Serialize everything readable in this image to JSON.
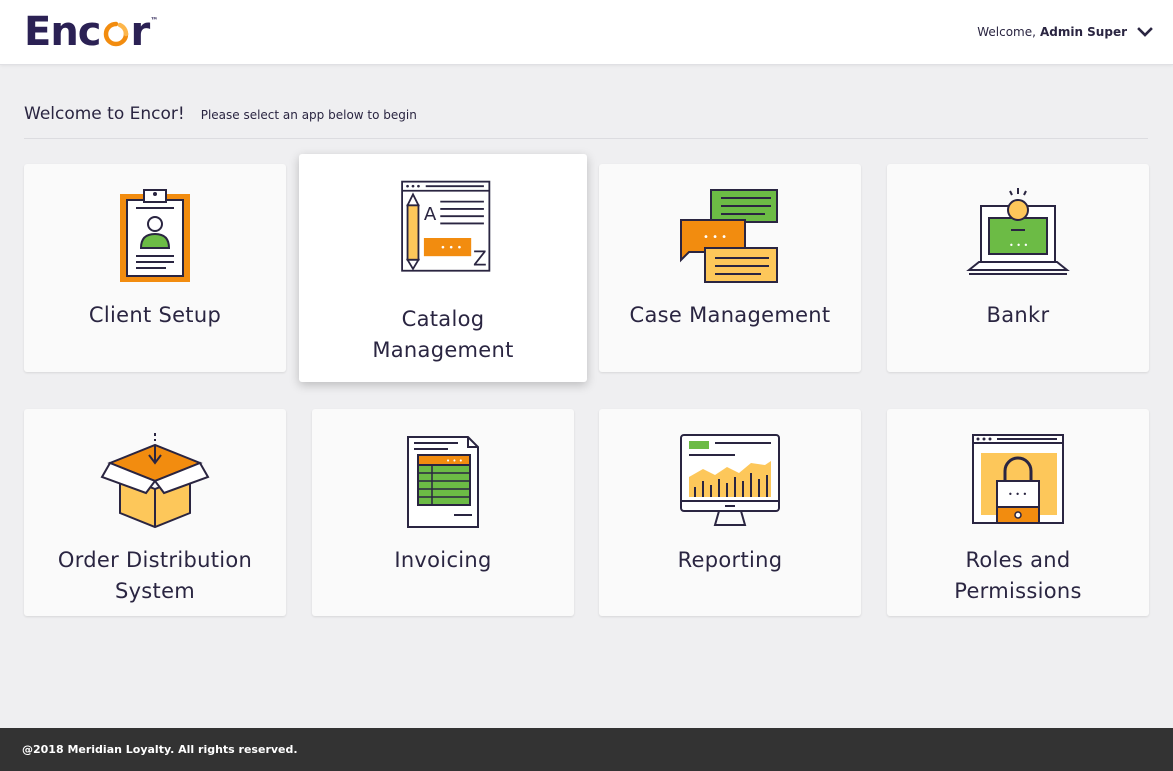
{
  "header": {
    "logo_text_left": "Enc",
    "logo_text_right": "r",
    "logo_tm": "™",
    "welcome_prefix": "Welcome,",
    "user_name": "Admin Super"
  },
  "intro": {
    "title": "Welcome to Encor!",
    "subtitle": "Please select an app below to begin"
  },
  "apps": [
    {
      "line1": "Client Setup",
      "line2": "",
      "icon": "clipboard-user-icon"
    },
    {
      "line1": "Catalog",
      "line2": "Management",
      "icon": "catalog-document-icon"
    },
    {
      "line1": "Case Management",
      "line2": "",
      "icon": "chat-bubbles-icon"
    },
    {
      "line1": "Bankr",
      "line2": "",
      "icon": "laptop-coin-icon"
    },
    {
      "line1": "Order Distribution",
      "line2": "System",
      "icon": "open-box-icon"
    },
    {
      "line1": "Invoicing",
      "line2": "",
      "icon": "invoice-sheet-icon"
    },
    {
      "line1": "Reporting",
      "line2": "",
      "icon": "monitor-chart-icon"
    },
    {
      "line1": "Roles and",
      "line2": "Permissions",
      "icon": "lock-window-icon"
    }
  ],
  "footer": {
    "copyright": "@2018 Meridian Loyalty. All rights reserved."
  },
  "colors": {
    "brand": "#2b2154",
    "accent": "#f28c0f",
    "green": "#6cbb45",
    "yellow": "#fdc75a",
    "footer_bg": "#333333"
  }
}
